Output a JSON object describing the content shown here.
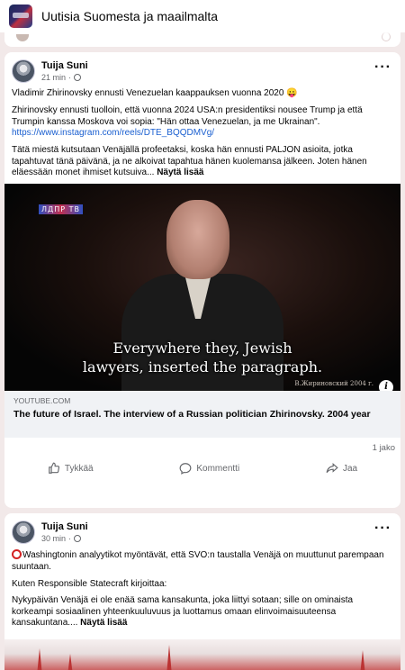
{
  "group": {
    "title": "Uutisia Suomesta ja maailmalta"
  },
  "posts": [
    {
      "author": "Tuija Suni",
      "time": "21 min",
      "paragraphs": {
        "p1": "Vladimir Zhirinovsky ennusti Venezuelan kaappauksen vuonna 2020 😛",
        "p2": "Zhirinovsky ennusti tuolloin, että vuonna 2024 USA:n presidentiksi nousee Trump ja että Trumpin kanssa Moskova voi sopia: \"Hän ottaa Venezuelan, ja me Ukrainan\".",
        "p2_link": "https://www.instagram.com/reels/DTE_BQQDMVg/",
        "p3": "Tätä miestä kutsutaan Venäjällä profeetaksi, koska hän ennusti PALJON asioita, jotka tapahtuvat tänä päivänä, ja ne alkoivat tapahtua hänen kuolemansa jälkeen. Joten hänen eläessään monet ihmiset kutsuiva...",
        "see_more": "Näytä lisää"
      },
      "video": {
        "channel_logo": "ЛДПР ТВ",
        "subtitle_line1": "Everywhere they, Jewish",
        "subtitle_line2": "lawyers, inserted the paragraph.",
        "caption": "В.Жириновский 2004 г.",
        "info_icon": "i"
      },
      "link_preview": {
        "domain": "YOUTUBE.COM",
        "title": "The future of Israel. The interview of a Russian politician Zhirinovsky. 2004 year"
      },
      "shares": "1 jako",
      "actions": {
        "like": "Tykkää",
        "comment": "Kommentti",
        "share": "Jaa"
      }
    },
    {
      "author": "Tuija Suni",
      "time": "30 min",
      "paragraphs": {
        "p1": "Washingtonin analyytikot myöntävät, että SVO:n taustalla Venäjä on muuttunut parempaan suuntaan.",
        "p2": "Kuten Responsible Statecraft kirjoittaa:",
        "p3": "Nykypäivän Venäjä ei ole enää sama kansakunta, joka liittyi sotaan; sille on ominaista korkeampi sosiaalinen yhteenkuuluvuus ja luottamus omaan elinvoimaisuuteensa kansakuntana....",
        "see_more": "Näytä lisää"
      }
    }
  ],
  "icons": {
    "group": "group-thumbnail",
    "globe": "globe-icon",
    "more": "more-options-icon",
    "like": "thumbs-up-icon",
    "comment": "comment-bubble-icon",
    "share": "share-arrow-icon",
    "info": "info-icon"
  },
  "colors": {
    "link": "#1a5fd0",
    "background": "#f2e9e9",
    "accent_red": "#d32222"
  }
}
